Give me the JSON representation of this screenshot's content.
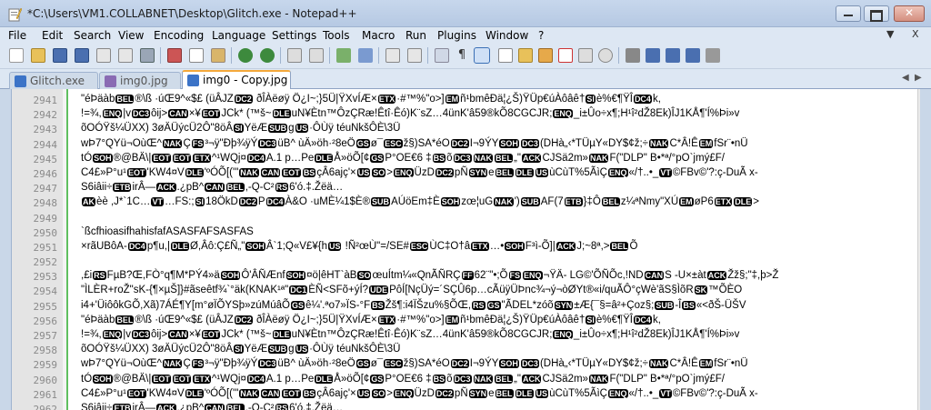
{
  "window": {
    "title": "*C:\\Users\\VM1.COLLABNET\\Desktop\\Glitch.exe - Notepad++"
  },
  "menu": [
    "File",
    "Edit",
    "Search",
    "View",
    "Encoding",
    "Language",
    "Settings",
    "Tools",
    "Macro",
    "Run",
    "Plugins",
    "Window",
    "?"
  ],
  "menu_right": {
    "collapse": "▼",
    "close": "X"
  },
  "tabs": [
    {
      "label": "Glitch.exe",
      "icon_color": "#3b73c7",
      "active": false
    },
    {
      "label": "img0.jpg",
      "icon_color": "#3b73c7",
      "active": false
    },
    {
      "label": "img0 - Copy.jpg",
      "icon_color": "#3b73c7",
      "active": true
    }
  ],
  "lines": [
    {
      "n": "2941",
      "text": "\"éÞäàb[BEL]®\\ß ·úŒ9^«$£ (üÂJZ[DC2] ðÎÀëøÿ Ö¿I~;}5Ü|ŸXvÍÆ×[ETX]·#™%\"o>][EM]ñ¹bmêÐä¦¿Š)ŸÜp€úÀôâê†[SI]è%€¶ŸÎ[DC4]k,"
    },
    {
      "n": "2942",
      "text": "!=¾,[ENQ]|v[DC3]ôij>[CAN]×¥[EOT]JCk* (™š~[DLE]uN¥Ètn™ÔzÇRæ!Êtî·Êó)K¨sZ…4ünK'â59®kÕ8CGCJR;[ENQ]_i±Ûo÷x¶;H¹î²dŽ8Ek)ÎJ1KÅ¶'Í%Þi»v"
    },
    {
      "n": "2943",
      "text": "õOÓŸš¼ÜXX) 3øÄÜýcÜ2Ô\"8öÂ[SI]YëÆ[SUB]g[US]·ÔÙÿ téuNkšÔÈ\\3Ü"
    },
    {
      "n": "2944",
      "text": "wÞ7°QYü¬OùŒ^[NAK]Ç[FS]³¬ÿ\"Ðþ¾ÿÝ[DC3]üB^ ùÄ»öh·²8eÖ[GS]ø¯[ESC]ž§)SA*éO[DC2]I¬9ÝY[SOH][DC3](DHà„‹*TÜµY«DY$¢ž;÷[NAK]C*Â!Ê[EM]fSr¨•nÜ"
    },
    {
      "n": "2945",
      "text": "tÓ[SOH]®@BÄ\\|[EOT][EOT][ETX]^¹WQj¤[DC4]A.1 p…Pe[DLE]Å»öÕ[¢[GS]P°OE€6    ‡[BS]õ[DC3][NAK][BEL]„\"[ACK]CJSä2m»[NAK]F(\"DLP\" B•*ª/°pO`jmý£F/"
    },
    {
      "n": "2946",
      "text": "C4£»P°u¹[EOT]'KW4¤V[DLE]'ºÓÕ[('\"[NAK][CAN][EOT][BS]çÂ6ajç'×[US][SO]>[ENQ]ÜzD[DC2]pÑ[SYN]e[BEL][DLE][US]ùCùT%5ÃìÇ[ENQ]«/†..•_[VT]©FBv©'?:ç-DuÃ  x-"
    },
    {
      "n": "2947",
      "text": "S6iâii÷[ETB]irÂ—[ACK].¿pB^[CAN][BEL],-Q-C²[RS]6'ó.‡.Žëä…"
    },
    {
      "n": "2948",
      "text": "[AK]èè ,J*`1C…[VT]…FS:;[SI]18ÖkD[DC2]P[DC4]À&O ·uMÈ¼1$È®[SUB]AÚöEm‡È[SOH]zœ¦uG[NAK]')[SUB]AF(7[ETB]}‡Ô[BEL]z¼ªNmy\"XÚ[EM]øP6[ETX][DLE]>"
    },
    {
      "n": "2949",
      "text": ""
    },
    {
      "n": "2950",
      "text": "`ßcfhioasifhahisfafASASFAFSASFAS"
    },
    {
      "n": "2951",
      "text": "×rãUBôA-[DC4]p¶u,|[DLE]Ø,Âô:Ç£Ñ„\"[SOH]Â`1;Q«V£¥{h[US] !Ñ²œÙ\"=/SE#[ESC]ÙC‡O†â[ETX]…•[SOH]F³ì-Õ]|[ACK]J;~8ª,>[BEL]Õ"
    },
    {
      "n": "2952",
      "text": ""
    },
    {
      "n": "2953",
      "text": ",£i[RS]FµB?Œ,FÒ°q¶M*PÝ4»ä[SOH]Ô'ÂÑÆnf[SOH]¤ö|êHT`àB[SO]œuÍtm¼«QnÃÑRÇ[FF]62¨\"•;Õ[FS][ENQ]¬ŸÄ- LG©'ÕÑÕc,!ND[CAN]S -U×±àt[ACK]Žž§;\"‡,þ>Ž"
    },
    {
      "n": "2954",
      "text": "\"ÌLÈR+roŽ\"sK-{¶×µŠ]}#ãseêtf¾`°äk(KNAK¹ª\"[DC1]ÈÑ<SFõ+ýÍ?[UDE]PôÍ[NçÜý=´SÇÛ6p…cÃüÿÜÞnc¾¬ý¬òØYt®«i/quÃÔ°çWè'ãS§ÌõR[SK]™ÕÈO"
    },
    {
      "n": "2955",
      "text": "i4+'ÜiôôkGÕ,Xã)7ÁÉ¶Y[m°øÏÕYSþ»zúMúâÕ[GS]ê¼'.ªo7»ÏS-°F[BS]Žš¶:i4ÏŠzu%§ÕŒ,[RS][GS]\"ÃDEL*zóõ[SYN]±Æ{¯§=â²+Çoz§;[SUB]-Î[BS]«<ðŠ-ÜŠV"
    },
    {
      "n": "2956",
      "text": "\"éÞäàb[BEL]®\\ß ·úŒ9^«$£ (üÂJZ[DC2] ðÎÀëøÿ Ö¿I~;}5Ü|ŸXvÍÆ×[ETX]·#™%\"o>][EM]ñ¹bmêÐä¦¿Š)ŸÜp€úÀôâê†[SI]è%€¶ŸÎ[DC4]k,"
    },
    {
      "n": "2957",
      "text": "!=¾,[ENQ]|v[DC3]ôij>[CAN]×¥[EOT]JCk* (™š~[DLE]uN¥Ètn™ÔzÇRæ!Êtî·Êó)K¨sZ…4ünK'â59®kÕ8CGCJR;[ENQ]_i±Ûo÷x¶;H¹î²dŽ8Ek)ÎJ1KÅ¶'Í%Þi»v"
    },
    {
      "n": "2958",
      "text": "õOÓŸš¼ÜXX) 3øÄÜýcÜ2Ô\"8öÂ[SI]YëÆ[SUB]g[US]·ÔÙÿ téuNkšÔÈ\\3Ü"
    },
    {
      "n": "2959",
      "text": "wÞ7°QYü¬OùŒ^[NAK]Ç[FS]³¬ÿ\"Ðþ¾ÿÝ[DC3]üB^ ùÄ»öh·²8eÖ[GS]ø¯[ESC]ž§)SA*éO[DC2]I¬9ÝY[SOH][DC3](DHà„‹*TÜµY«DY$¢ž;÷[NAK]C*Â!Ê[EM]fSr¨•nÜ"
    },
    {
      "n": "2960",
      "text": "tÓ[SOH]®@BÄ\\|[EOT][EOT][ETX]^¹WQj¤[DC4]A.1 p…Pe[DLE]Å»öÕ[¢[GS]P°OE€6    ‡[BS]õ[DC3][NAK][BEL]„\"[ACK]CJSä2m»[NAK]F(\"DLP\" B•*ª/°pO`jmý£F/"
    },
    {
      "n": "2961",
      "text": "C4£»P°u¹[EOT]'KW4¤V[DLE]'ºÓÕ[('\"[NAK][CAN][EOT][BS]çÂ6ajç'×[US][SO]>[ENQ]ÜzD[DC2]pÑ[SYN]e[BEL][DLE][US]ùCùT%5ÃìÇ[ENQ]«/†..•_[VT]©FBv©'?:ç-DuÃ  x-"
    },
    {
      "n": "2962",
      "text": "S6iâii÷[ETB]irÂ—[ACK].¿pB^[CAN][BEL],-Q-C²[RS]6'ó.‡.Žëä…"
    }
  ],
  "colors": {
    "accent_tab": "#f4a83a",
    "fold_line": "#5fbf5f"
  }
}
